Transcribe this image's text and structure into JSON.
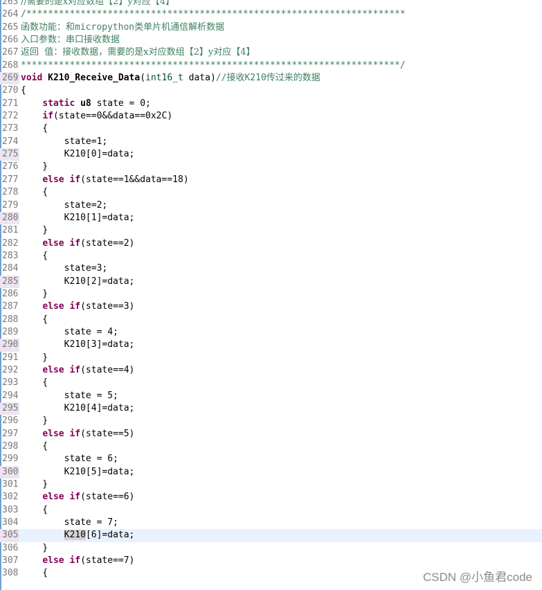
{
  "lines": [
    {
      "n": "263",
      "html": "<span class=\"cmcn\">//需要的是x对应数组【2】y对应【4】</span>"
    },
    {
      "n": "264",
      "html": "<span class=\"cm\">/**********************************************************************</span>"
    },
    {
      "n": "265",
      "html": "<span class=\"cmcn\">函数功能：和</span><span class=\"cm\">micropython</span><span class=\"cmcn\">类单片机通信解析数据</span>"
    },
    {
      "n": "266",
      "html": "<span class=\"cmcn\">入口参数：串口接收数据</span>"
    },
    {
      "n": "267",
      "html": "<span class=\"cmcn\">返回  值：接收数据，需要的是x对应数组【2】y对应【4】</span>"
    },
    {
      "n": "268",
      "html": "<span class=\"cm\">**********************************************************************/</span>"
    },
    {
      "n": "269",
      "mark": true,
      "html": "<span class=\"kw\">void</span> <span class=\"bold\">K210_Receive_Data</span>(<span class=\"type\">int16_t</span> data)<span class=\"cm\">//</span><span class=\"cmcn\">接收</span><span class=\"cm\">K210</span><span class=\"cmcn\">传过来的数据</span>"
    },
    {
      "n": "270",
      "html": "{"
    },
    {
      "n": "271",
      "html": "    <span class=\"kw\">static</span> <span class=\"bold\">u8</span> state = 0;"
    },
    {
      "n": "272",
      "html": "    <span class=\"kw\">if</span>(state==0&amp;&amp;data==0x2C)"
    },
    {
      "n": "273",
      "html": "    {"
    },
    {
      "n": "274",
      "html": "        state=1;"
    },
    {
      "n": "275",
      "mark": true,
      "html": "        K210[0]=data;"
    },
    {
      "n": "276",
      "html": "    }"
    },
    {
      "n": "277",
      "html": "    <span class=\"kw\">else</span> <span class=\"kw\">if</span>(state==1&amp;&amp;data==18)"
    },
    {
      "n": "278",
      "html": "    {"
    },
    {
      "n": "279",
      "html": "        state=2;"
    },
    {
      "n": "280",
      "mark": true,
      "html": "        K210[1]=data;"
    },
    {
      "n": "281",
      "html": "    }"
    },
    {
      "n": "282",
      "html": "    <span class=\"kw\">else</span> <span class=\"kw\">if</span>(state==2)"
    },
    {
      "n": "283",
      "html": "    {"
    },
    {
      "n": "284",
      "html": "        state=3;"
    },
    {
      "n": "285",
      "mark": true,
      "html": "        K210[2]=data;"
    },
    {
      "n": "286",
      "html": "    }"
    },
    {
      "n": "287",
      "html": "    <span class=\"kw\">else</span> <span class=\"kw\">if</span>(state==3)"
    },
    {
      "n": "288",
      "html": "    {"
    },
    {
      "n": "289",
      "html": "        state = 4;"
    },
    {
      "n": "290",
      "mark": true,
      "html": "        K210[3]=data;"
    },
    {
      "n": "291",
      "html": "    }"
    },
    {
      "n": "292",
      "html": "    <span class=\"kw\">else</span> <span class=\"kw\">if</span>(state==4)"
    },
    {
      "n": "293",
      "html": "    {"
    },
    {
      "n": "294",
      "html": "        state = 5;"
    },
    {
      "n": "295",
      "mark": true,
      "html": "        K210[4]=data;"
    },
    {
      "n": "296",
      "html": "    }"
    },
    {
      "n": "297",
      "html": "    <span class=\"kw\">else</span> <span class=\"kw\">if</span>(state==5)"
    },
    {
      "n": "298",
      "html": "    {"
    },
    {
      "n": "299",
      "html": "        state = 6;"
    },
    {
      "n": "300",
      "mark": true,
      "html": "        K210[5]=data;"
    },
    {
      "n": "301",
      "html": "    }"
    },
    {
      "n": "302",
      "html": "    <span class=\"kw\">else</span> <span class=\"kw\">if</span>(state==6)"
    },
    {
      "n": "303",
      "html": "    {"
    },
    {
      "n": "304",
      "html": "        state = 7;"
    },
    {
      "n": "305",
      "mark": true,
      "current": true,
      "html": "        <span class=\"hl\">K210</span>[6]=data;"
    },
    {
      "n": "306",
      "html": "    }"
    },
    {
      "n": "307",
      "html": "    <span class=\"kw\">else</span> <span class=\"kw\">if</span>(state==7)"
    },
    {
      "n": "308",
      "html": "    {"
    }
  ],
  "watermark": "CSDN @小鱼君code",
  "colors": {
    "keyword": "#7f0055",
    "comment": "#3f7f5f",
    "gutter_mark": "#ece4f1",
    "current_line": "#e8f2fe"
  }
}
